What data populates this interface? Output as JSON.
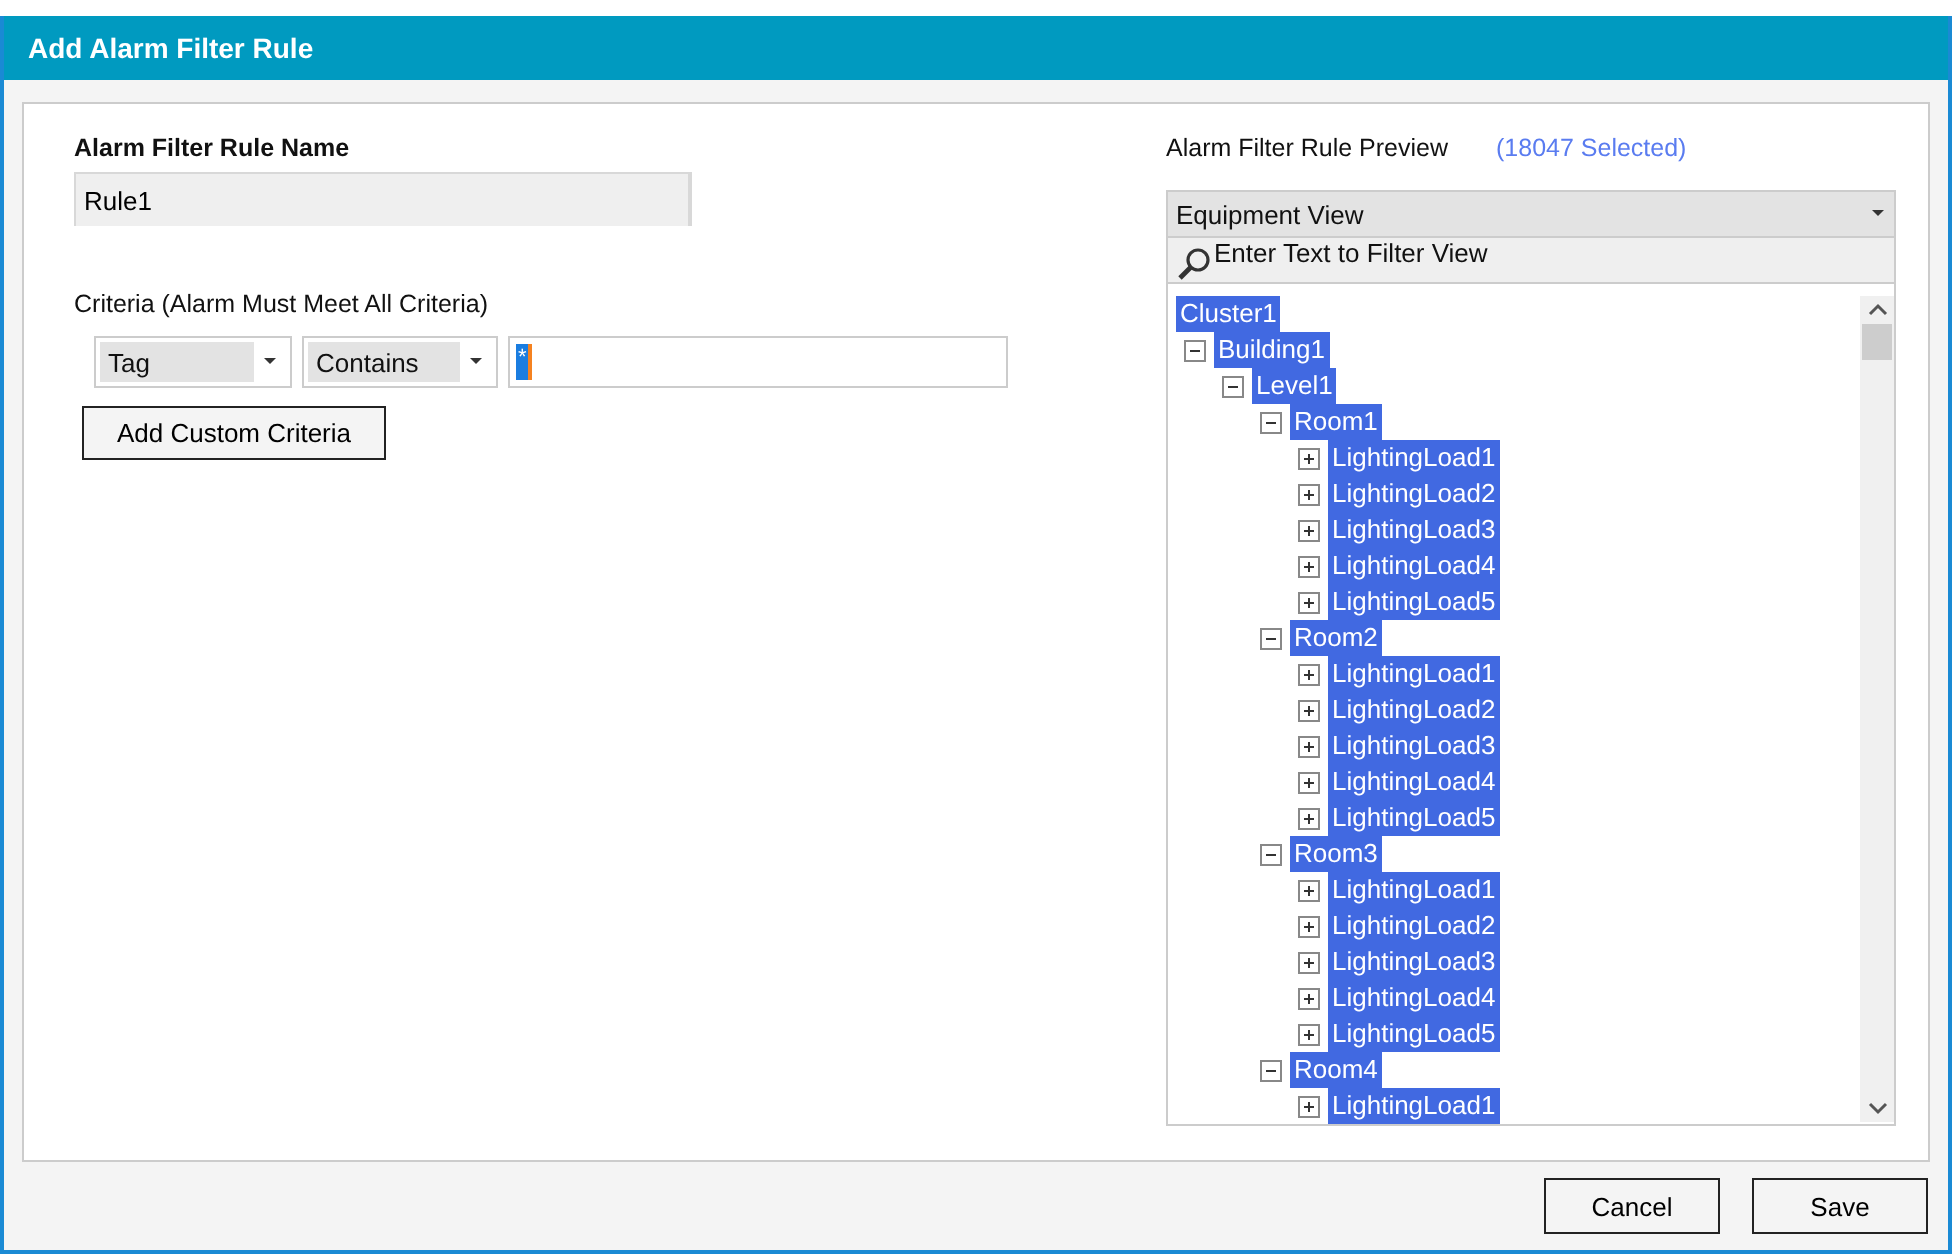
{
  "window": {
    "title": "Add Alarm Filter Rule"
  },
  "rule_name": {
    "label": "Alarm Filter Rule Name",
    "value": "Rule1"
  },
  "criteria": {
    "label": "Criteria (Alarm Must Meet All Criteria)",
    "field": "Tag",
    "operator": "Contains",
    "value": "*",
    "add_button": "Add Custom Criteria"
  },
  "preview": {
    "label": "Alarm Filter Rule Preview",
    "count": "(18047 Selected)",
    "view": "Equipment View",
    "filter_placeholder": "Enter Text to Filter View",
    "tree": [
      {
        "label": "Cluster1",
        "selected": true,
        "children": [
          {
            "label": "Building1",
            "selected": true,
            "expanded": true,
            "children": [
              {
                "label": "Level1",
                "selected": true,
                "expanded": true,
                "children": [
                  {
                    "label": "Room1",
                    "selected": true,
                    "expanded": true,
                    "children": [
                      {
                        "label": "LightingLoad1",
                        "selected": true,
                        "expanded": false
                      },
                      {
                        "label": "LightingLoad2",
                        "selected": true,
                        "expanded": false
                      },
                      {
                        "label": "LightingLoad3",
                        "selected": true,
                        "expanded": false
                      },
                      {
                        "label": "LightingLoad4",
                        "selected": true,
                        "expanded": false
                      },
                      {
                        "label": "LightingLoad5",
                        "selected": true,
                        "expanded": false
                      }
                    ]
                  },
                  {
                    "label": "Room2",
                    "selected": true,
                    "expanded": true,
                    "children": [
                      {
                        "label": "LightingLoad1",
                        "selected": true,
                        "expanded": false
                      },
                      {
                        "label": "LightingLoad2",
                        "selected": true,
                        "expanded": false
                      },
                      {
                        "label": "LightingLoad3",
                        "selected": true,
                        "expanded": false
                      },
                      {
                        "label": "LightingLoad4",
                        "selected": true,
                        "expanded": false
                      },
                      {
                        "label": "LightingLoad5",
                        "selected": true,
                        "expanded": false
                      }
                    ]
                  },
                  {
                    "label": "Room3",
                    "selected": true,
                    "expanded": true,
                    "children": [
                      {
                        "label": "LightingLoad1",
                        "selected": true,
                        "expanded": false
                      },
                      {
                        "label": "LightingLoad2",
                        "selected": true,
                        "expanded": false
                      },
                      {
                        "label": "LightingLoad3",
                        "selected": true,
                        "expanded": false
                      },
                      {
                        "label": "LightingLoad4",
                        "selected": true,
                        "expanded": false
                      },
                      {
                        "label": "LightingLoad5",
                        "selected": true,
                        "expanded": false
                      }
                    ]
                  },
                  {
                    "label": "Room4",
                    "selected": true,
                    "expanded": true,
                    "children": [
                      {
                        "label": "LightingLoad1",
                        "selected": true,
                        "expanded": false
                      }
                    ]
                  }
                ]
              }
            ]
          }
        ]
      }
    ]
  },
  "buttons": [
    "Cancel",
    "Save"
  ]
}
